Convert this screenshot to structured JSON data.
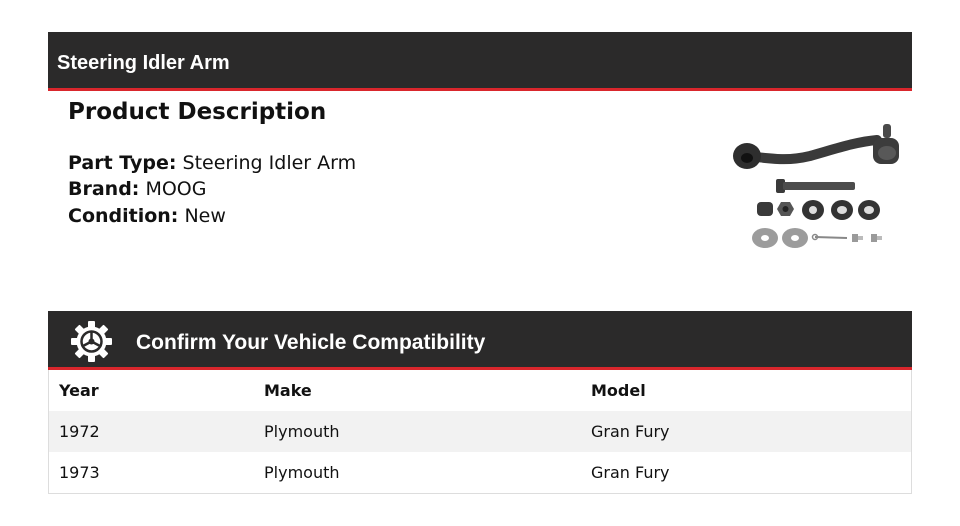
{
  "header": {
    "title": "Steering Idler Arm"
  },
  "description": {
    "heading": "Product Description",
    "attributes": [
      {
        "label": "Part Type:",
        "value": "Steering Idler Arm"
      },
      {
        "label": "Brand:",
        "value": "MOOG"
      },
      {
        "label": "Condition:",
        "value": "New"
      }
    ]
  },
  "compatibility": {
    "title": "Confirm Your Vehicle Compatibility",
    "icon": "gear-steering-wheel-icon",
    "columns": [
      "Year",
      "Make",
      "Model"
    ],
    "rows": [
      [
        "1972",
        "Plymouth",
        "Gran Fury"
      ],
      [
        "1973",
        "Plymouth",
        "Gran Fury"
      ]
    ]
  },
  "colors": {
    "bar_background": "#2b2a2a",
    "accent_red": "#d9262c",
    "row_alt": "#f2f2f2"
  }
}
